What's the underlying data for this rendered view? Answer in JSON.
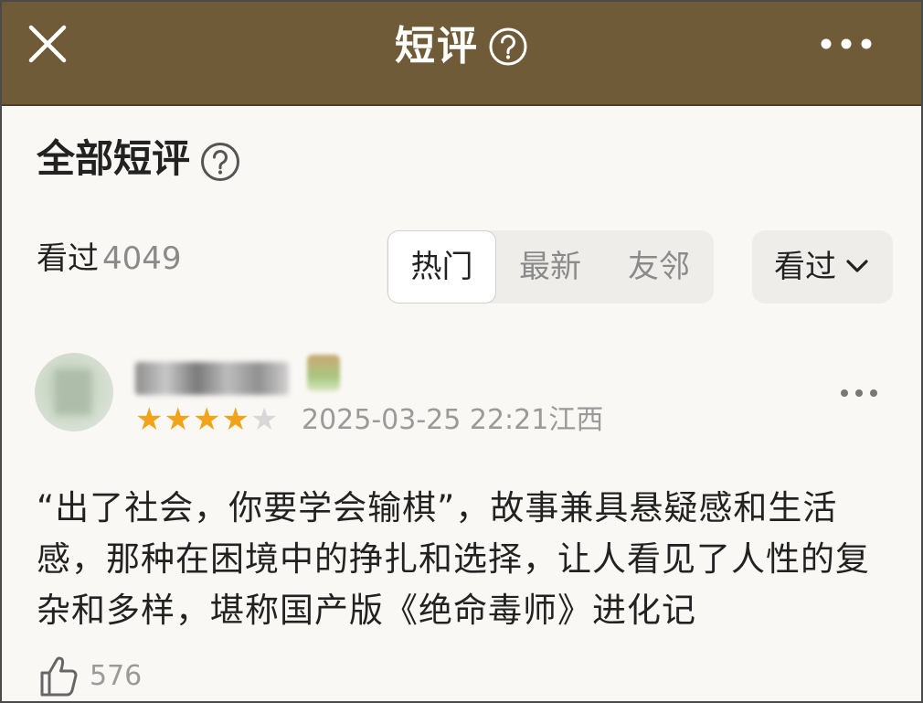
{
  "topbar": {
    "title": "短评",
    "close_icon": "close-icon",
    "help_icon": "help-icon",
    "more_icon": "more-icon"
  },
  "section": {
    "title": "全部短评",
    "help_icon": "help-icon"
  },
  "summary": {
    "label": "看过",
    "count": "4049"
  },
  "sort_tabs": [
    {
      "label": "热门",
      "active": true
    },
    {
      "label": "最新",
      "active": false
    },
    {
      "label": "友邻",
      "active": false
    }
  ],
  "filter": {
    "selected": "看过",
    "icon": "chevron-down-icon"
  },
  "review": {
    "username": "",
    "rating": 4,
    "rating_max": 5,
    "timestamp": "2025-03-25 22:21",
    "location": "江西",
    "text": "“出了社会，你要学会输棋”，故事兼具悬疑感和生活感，那种在困境中的挣扎和选择，让人看见了人性的复杂和多样，堪称国产版《绝命毒师》进化记",
    "likes": "576"
  },
  "colors": {
    "topbar": "#6f5b38",
    "star": "#f3a31a",
    "background": "#faf8f4"
  }
}
